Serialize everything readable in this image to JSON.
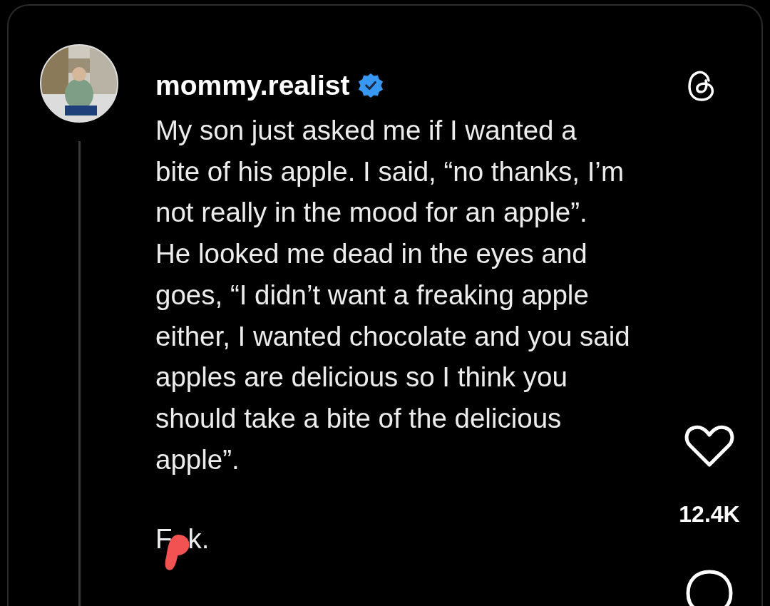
{
  "post": {
    "username": "mommy.realist",
    "verified": true,
    "lines": [
      "My son just asked me if I wanted a",
      "bite of his apple. I said, “no thanks, I’m",
      "not really in the mood for an apple”.",
      "He looked me dead in the eyes and",
      "goes, “I didn’t want a freaking apple",
      "either, I wanted chocolate and you said",
      "apples are delicious so I think you",
      "should take a bite of the delicious",
      "apple”."
    ],
    "censored_word": {
      "before": "F",
      "after": "k."
    }
  },
  "actions": {
    "likes": "12.4K",
    "liked": false
  }
}
